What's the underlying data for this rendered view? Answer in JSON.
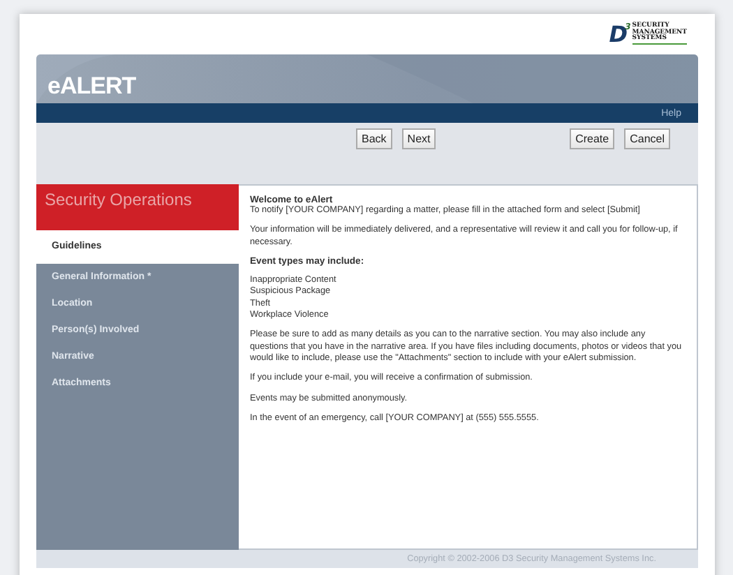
{
  "logo": {
    "letter": "D",
    "superscript": "3",
    "lines": [
      "SECURITY",
      "MANAGEMENT",
      "SYSTEMS"
    ]
  },
  "app_title": "eALERT",
  "help_link": "Help",
  "toolbar": {
    "nav_buttons": [
      "Back",
      "Next"
    ],
    "action_buttons": [
      "Create",
      "Cancel"
    ]
  },
  "sidebar": {
    "title": "Security Operations",
    "items": [
      {
        "label": "Guidelines",
        "selected": true
      },
      {
        "label": "General Information *",
        "selected": false
      },
      {
        "label": "Location",
        "selected": false
      },
      {
        "label": "Person(s) Involved",
        "selected": false
      },
      {
        "label": "Narrative",
        "selected": false
      },
      {
        "label": "Attachments",
        "selected": false
      }
    ]
  },
  "content": [
    {
      "kind": "heading",
      "text": "Welcome to eAlert"
    },
    {
      "kind": "line",
      "text": "To notify [YOUR COMPANY] regarding a matter, please fill in the attached form and select [Submit]"
    },
    {
      "kind": "para",
      "text": "Your information will be immediately delivered, and a representative will review it and call you for follow-up, if necessary."
    },
    {
      "kind": "subheading",
      "text": "Event types may include:"
    },
    {
      "kind": "list",
      "items": [
        "Inappropriate Content",
        "Suspicious Package",
        "Theft",
        "Workplace Violence"
      ]
    },
    {
      "kind": "para",
      "text": "Please be sure to add as many details as you can to the narrative section.  You may also include any questions that you have in the narrative area.  If you have files including documents, photos or videos that you would like to include, please use the \"Attachments\" section to include with your eAlert submission."
    },
    {
      "kind": "para",
      "text": "If you include your e-mail, you will receive a confirmation of submission."
    },
    {
      "kind": "para",
      "text": "Events may be submitted anonymously."
    },
    {
      "kind": "para",
      "text": "In the event of an emergency, call [YOUR COMPANY] at (555) 555.5555."
    }
  ],
  "footer": "Copyright © 2002-2006 D3 Security Management Systems Inc."
}
